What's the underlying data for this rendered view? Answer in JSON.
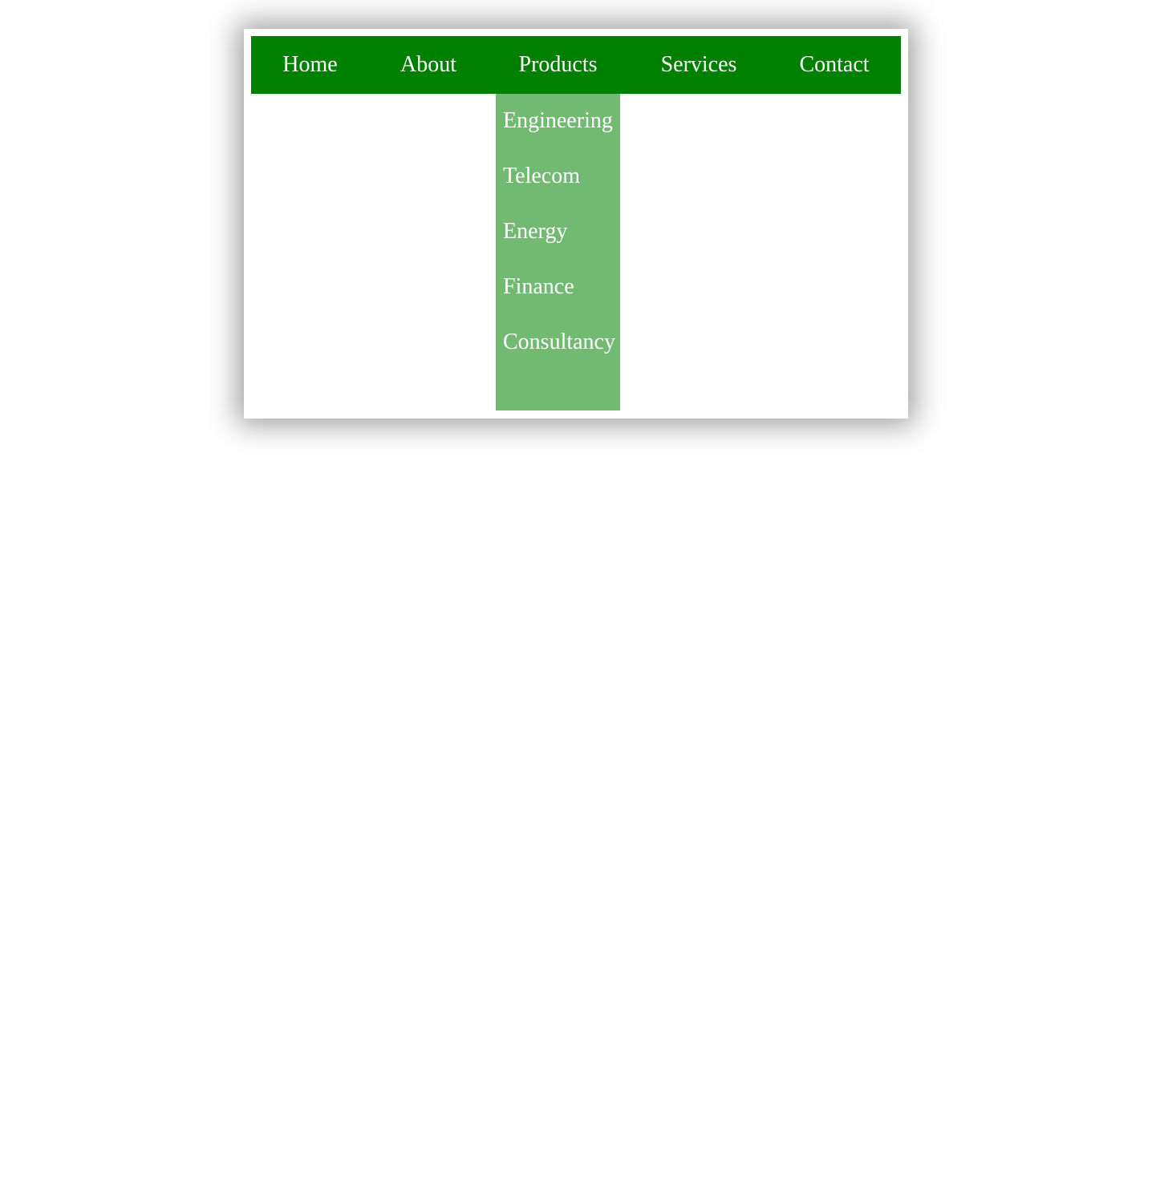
{
  "nav": {
    "items": [
      {
        "label": "Home"
      },
      {
        "label": "About"
      },
      {
        "label": "Products"
      },
      {
        "label": "Services"
      },
      {
        "label": "Contact"
      }
    ]
  },
  "dropdown": {
    "items": [
      {
        "label": "Engineering"
      },
      {
        "label": "Telecom"
      },
      {
        "label": "Energy"
      },
      {
        "label": "Finance"
      },
      {
        "label": "Consultancy"
      }
    ]
  },
  "colors": {
    "navbar": "#008000",
    "dropdown": "#72b972",
    "text": "#ffffff"
  }
}
